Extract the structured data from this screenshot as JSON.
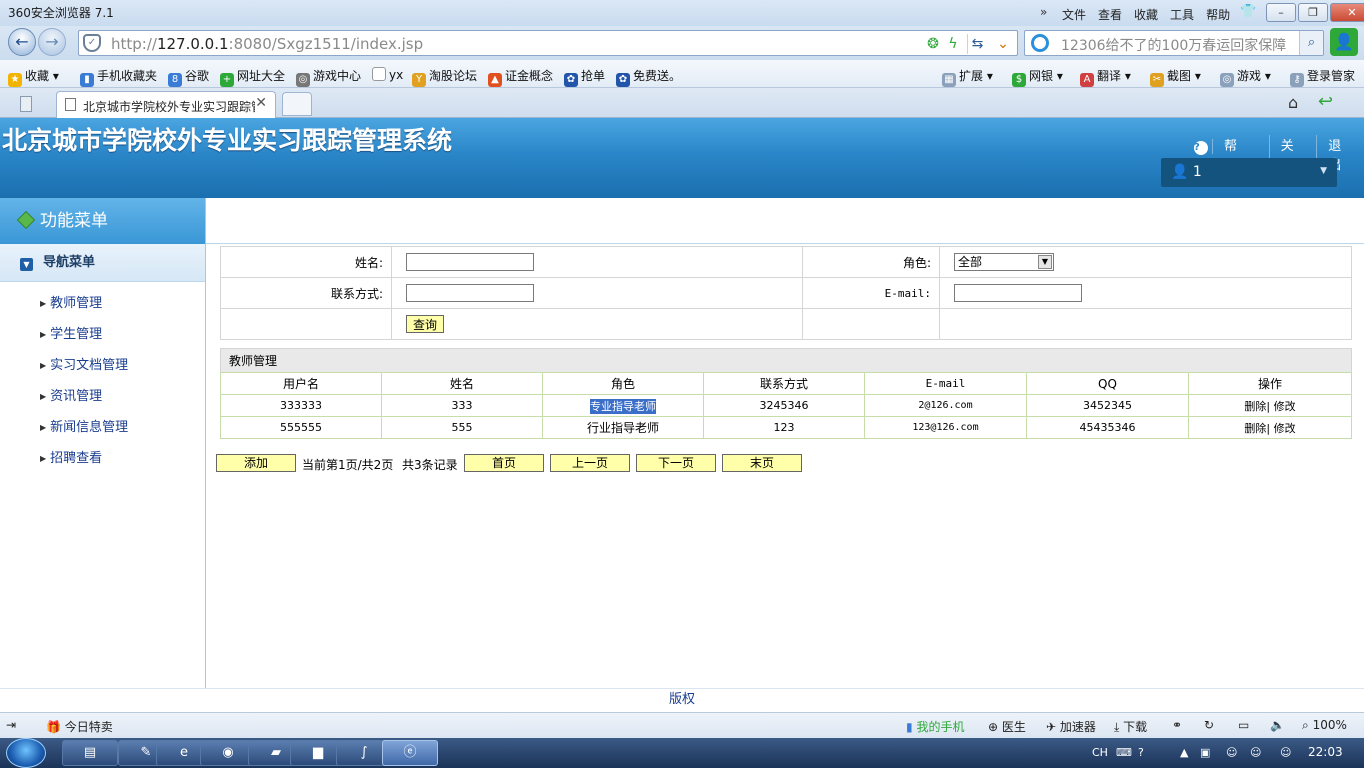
{
  "browser": {
    "window_title": "360安全浏览器 7.1",
    "menu": [
      "文件",
      "查看",
      "收藏",
      "工具",
      "帮助"
    ],
    "url_prefix": "http://",
    "url_host": "127.0.0.1",
    "url_rest": ":8080/Sxgz1511/index.jsp",
    "search_placeholder": "12306给不了的100万春运回家保障",
    "favorites": [
      "收藏",
      "手机收藏夹",
      "谷歌",
      "网址大全",
      "游戏中心",
      "yx",
      "淘股论坛",
      "证金概念",
      "抢单",
      "免费送。"
    ],
    "right_tools": [
      "扩展",
      "网银",
      "翻译",
      "截图",
      "游戏",
      "登录管家"
    ],
    "tab_title": "北京城市学院校外专业实习跟踪管理系统"
  },
  "app": {
    "title": "北京城市学院校外专业实习跟踪管理系统",
    "links": {
      "help": "帮助",
      "about": "关于",
      "logout": "退出"
    },
    "user": "1"
  },
  "sidebar": {
    "heading": "功能菜单",
    "nav_title": "导航菜单",
    "items": [
      "教师管理",
      "学生管理",
      "实习文档管理",
      "资讯管理",
      "新闻信息管理",
      "招聘查看"
    ]
  },
  "search_form": {
    "name_label": "姓名:",
    "role_label": "角色:",
    "role_value": "全部",
    "contact_label": "联系方式:",
    "email_label": "E-mail:",
    "query_button": "查询"
  },
  "grid": {
    "title": "教师管理",
    "columns": [
      "用户名",
      "姓名",
      "角色",
      "联系方式",
      "E-mail",
      "QQ",
      "操作"
    ],
    "rows": [
      {
        "username": "333333",
        "name": "333",
        "role": "专业指导老师",
        "contact": "3245346",
        "email": "2@126.com",
        "qq": "3452345",
        "actions": "删除| 修改"
      },
      {
        "username": "555555",
        "name": "555",
        "role": "行业指导老师",
        "contact": "123",
        "email": "123@126.com",
        "qq": "45435346",
        "actions": "删除| 修改"
      }
    ]
  },
  "pager": {
    "add": "添加",
    "page_info": "当前第1页/共2页",
    "record_info": "共3条记录",
    "first": "首页",
    "prev": "上一页",
    "next": "下一页",
    "last": "末页"
  },
  "footer": {
    "text": "版权"
  },
  "statusbar": {
    "left": "今日特卖",
    "items": [
      "我的手机",
      "医生",
      "加速器",
      "下载"
    ],
    "zoom": "100%"
  },
  "taskbar": {
    "lang": "CH",
    "time": "22:03"
  }
}
